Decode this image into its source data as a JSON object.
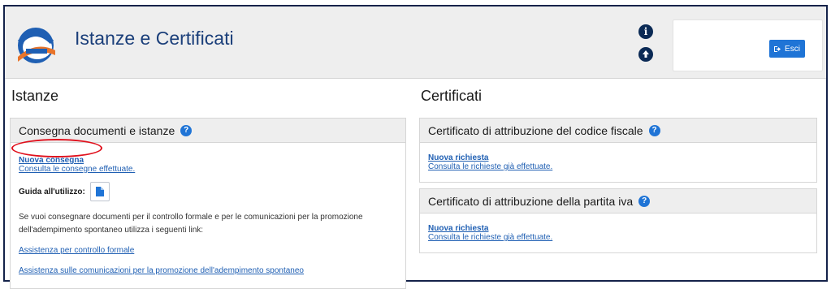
{
  "header": {
    "title": "Istanze e Certificati",
    "exit_label": "Esci",
    "icons": [
      "info-icon",
      "upload-icon",
      "logout-icon"
    ]
  },
  "istanze": {
    "title": "Istanze",
    "panel_title": "Consegna documenti e istanze",
    "new_delivery": "Nuova consegna",
    "view_deliveries": "Consulta le consegne effettuate.",
    "guide_label": "Guida all'utilizzo:",
    "info_text": "Se vuoi consegnare documenti per il controllo formale e per le comunicazioni per la promozione dell'adempimento spontaneo utilizza i seguenti link:",
    "link_formal_control": "Assistenza per controllo formale",
    "link_spontaneous": "Assistenza sulle comunicazioni per la promozione dell'adempimento spontaneo"
  },
  "certificati": {
    "title": "Certificati",
    "codice_fiscale": {
      "panel_title": "Certificato di attribuzione del codice fiscale",
      "new_request": "Nuova richiesta",
      "view_requests": "Consulta le richieste già effettuate."
    },
    "partita_iva": {
      "panel_title": "Certificato di attribuzione della partita iva",
      "new_request": "Nuova richiesta",
      "view_requests": "Consulta le richieste già effettuate."
    }
  },
  "colors": {
    "accent": "#1f74d6",
    "navy": "#0b2a55",
    "highlight": "#e0101c"
  }
}
